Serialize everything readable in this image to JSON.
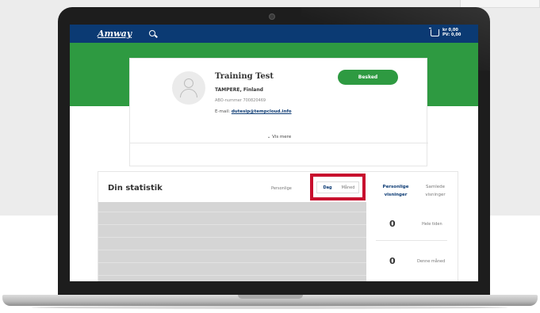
{
  "header": {
    "logo": "Amway",
    "cart_kr": "kr 0,00",
    "cart_pv": "PV: 0,00"
  },
  "profile": {
    "name": "Training Test",
    "location": "TAMPERE, Finland",
    "abo": "ABO-nummer 700820469",
    "email_label": "E-mail:",
    "email": "dutesip@tempcloud.info",
    "message_button": "Besked",
    "show_more": "⌄ Vis mere"
  },
  "stats": {
    "title": "Din statistik",
    "scope_label": "Personlige",
    "period_tabs": [
      "Dag",
      "Måned"
    ],
    "active_period": "Dag",
    "side_tabs": [
      "Personlige visninger",
      "Samlede visninger"
    ],
    "metrics": [
      {
        "value": "0",
        "label": "Hele tiden"
      },
      {
        "value": "0",
        "label": "Denne måned"
      }
    ]
  },
  "colors": {
    "brand_blue": "#0b3a73",
    "brand_green": "#2e9a41",
    "highlight_red": "#c8102e"
  }
}
